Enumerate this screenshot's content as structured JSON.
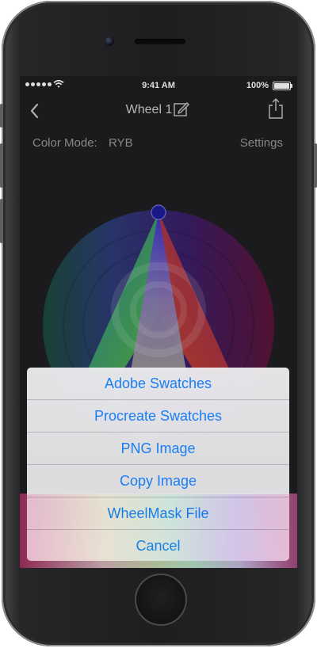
{
  "status_bar": {
    "time": "9:41 AM",
    "battery": "100%"
  },
  "nav": {
    "title": "Wheel 1"
  },
  "color_mode": {
    "label": "Color Mode:",
    "value": "RYB",
    "settings": "Settings"
  },
  "action_sheet": {
    "items": [
      "Adobe Swatches",
      "Procreate Swatches",
      "PNG Image",
      "Copy Image",
      "WheelMask File"
    ],
    "cancel": "Cancel"
  },
  "colors": {
    "accent": "#1a7ef5",
    "background": "#1f1f21",
    "selector": "#1c1c9a"
  },
  "icons": [
    "back-icon",
    "edit-icon",
    "share-icon",
    "wifi-icon",
    "battery-icon"
  ]
}
